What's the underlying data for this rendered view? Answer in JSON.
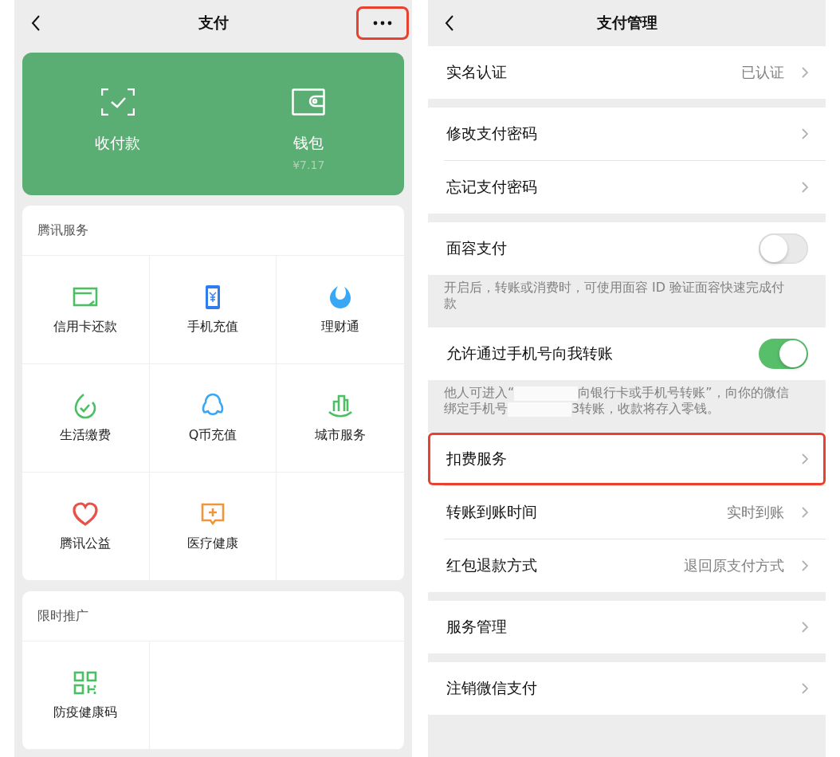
{
  "pay_screen": {
    "title": "支付",
    "more_button": {
      "highlighted": true
    },
    "wallet_card": [
      {
        "kind": "scan",
        "label": "收付款"
      },
      {
        "kind": "wallet",
        "label": "钱包",
        "sub": "¥7.17"
      }
    ],
    "sections": [
      {
        "title": "腾讯服务",
        "items": [
          {
            "kind": "card",
            "label": "信用卡还款"
          },
          {
            "kind": "phone",
            "label": "手机充值"
          },
          {
            "kind": "fish",
            "label": "理财通"
          },
          {
            "kind": "leaf",
            "label": "生活缴费"
          },
          {
            "kind": "penguin",
            "label": "Q币充值"
          },
          {
            "kind": "city",
            "label": "城市服务"
          },
          {
            "kind": "heart",
            "label": "腾讯公益"
          },
          {
            "kind": "medical",
            "label": "医疗健康"
          }
        ]
      },
      {
        "title": "限时推广",
        "items": [
          {
            "kind": "qr",
            "label": "防疫健康码"
          }
        ]
      }
    ]
  },
  "manage_screen": {
    "title": "支付管理",
    "groups": [
      {
        "rows": [
          {
            "kind": "link",
            "label": "实名认证",
            "value": "已认证",
            "highlighted": false
          }
        ]
      },
      {
        "rows": [
          {
            "kind": "link",
            "label": "修改支付密码",
            "highlighted": false
          },
          {
            "kind": "link",
            "label": "忘记支付密码",
            "highlighted": false
          }
        ]
      },
      {
        "rows": [
          {
            "kind": "toggle",
            "label": "面容支付",
            "on": false
          }
        ],
        "note": [
          {
            "kind": "text",
            "text": "开启后，转账或消费时，可使用面容 ID 验证面容快速完成付款"
          }
        ]
      },
      {
        "rows": [
          {
            "kind": "toggle",
            "label": "允许通过手机号向我转账",
            "on": true
          }
        ],
        "note": [
          {
            "kind": "text",
            "text": "他人可进入“"
          },
          {
            "kind": "redaction"
          },
          {
            "kind": "text",
            "text": "向银行卡或手机号转账”，向你的微信绑定手机号"
          },
          {
            "kind": "redaction"
          },
          {
            "kind": "text",
            "text": "3转账，收款将存入零钱。"
          }
        ]
      },
      {
        "rows": [
          {
            "kind": "link",
            "label": "扣费服务",
            "highlighted": true
          },
          {
            "kind": "link",
            "label": "转账到账时间",
            "value": "实时到账",
            "highlighted": false
          },
          {
            "kind": "link",
            "label": "红包退款方式",
            "value": "退回原支付方式",
            "highlighted": false
          }
        ]
      },
      {
        "rows": [
          {
            "kind": "link",
            "label": "服务管理",
            "highlighted": false
          }
        ]
      },
      {
        "rows": [
          {
            "kind": "link",
            "label": "注销微信支付",
            "highlighted": false
          }
        ]
      }
    ]
  }
}
